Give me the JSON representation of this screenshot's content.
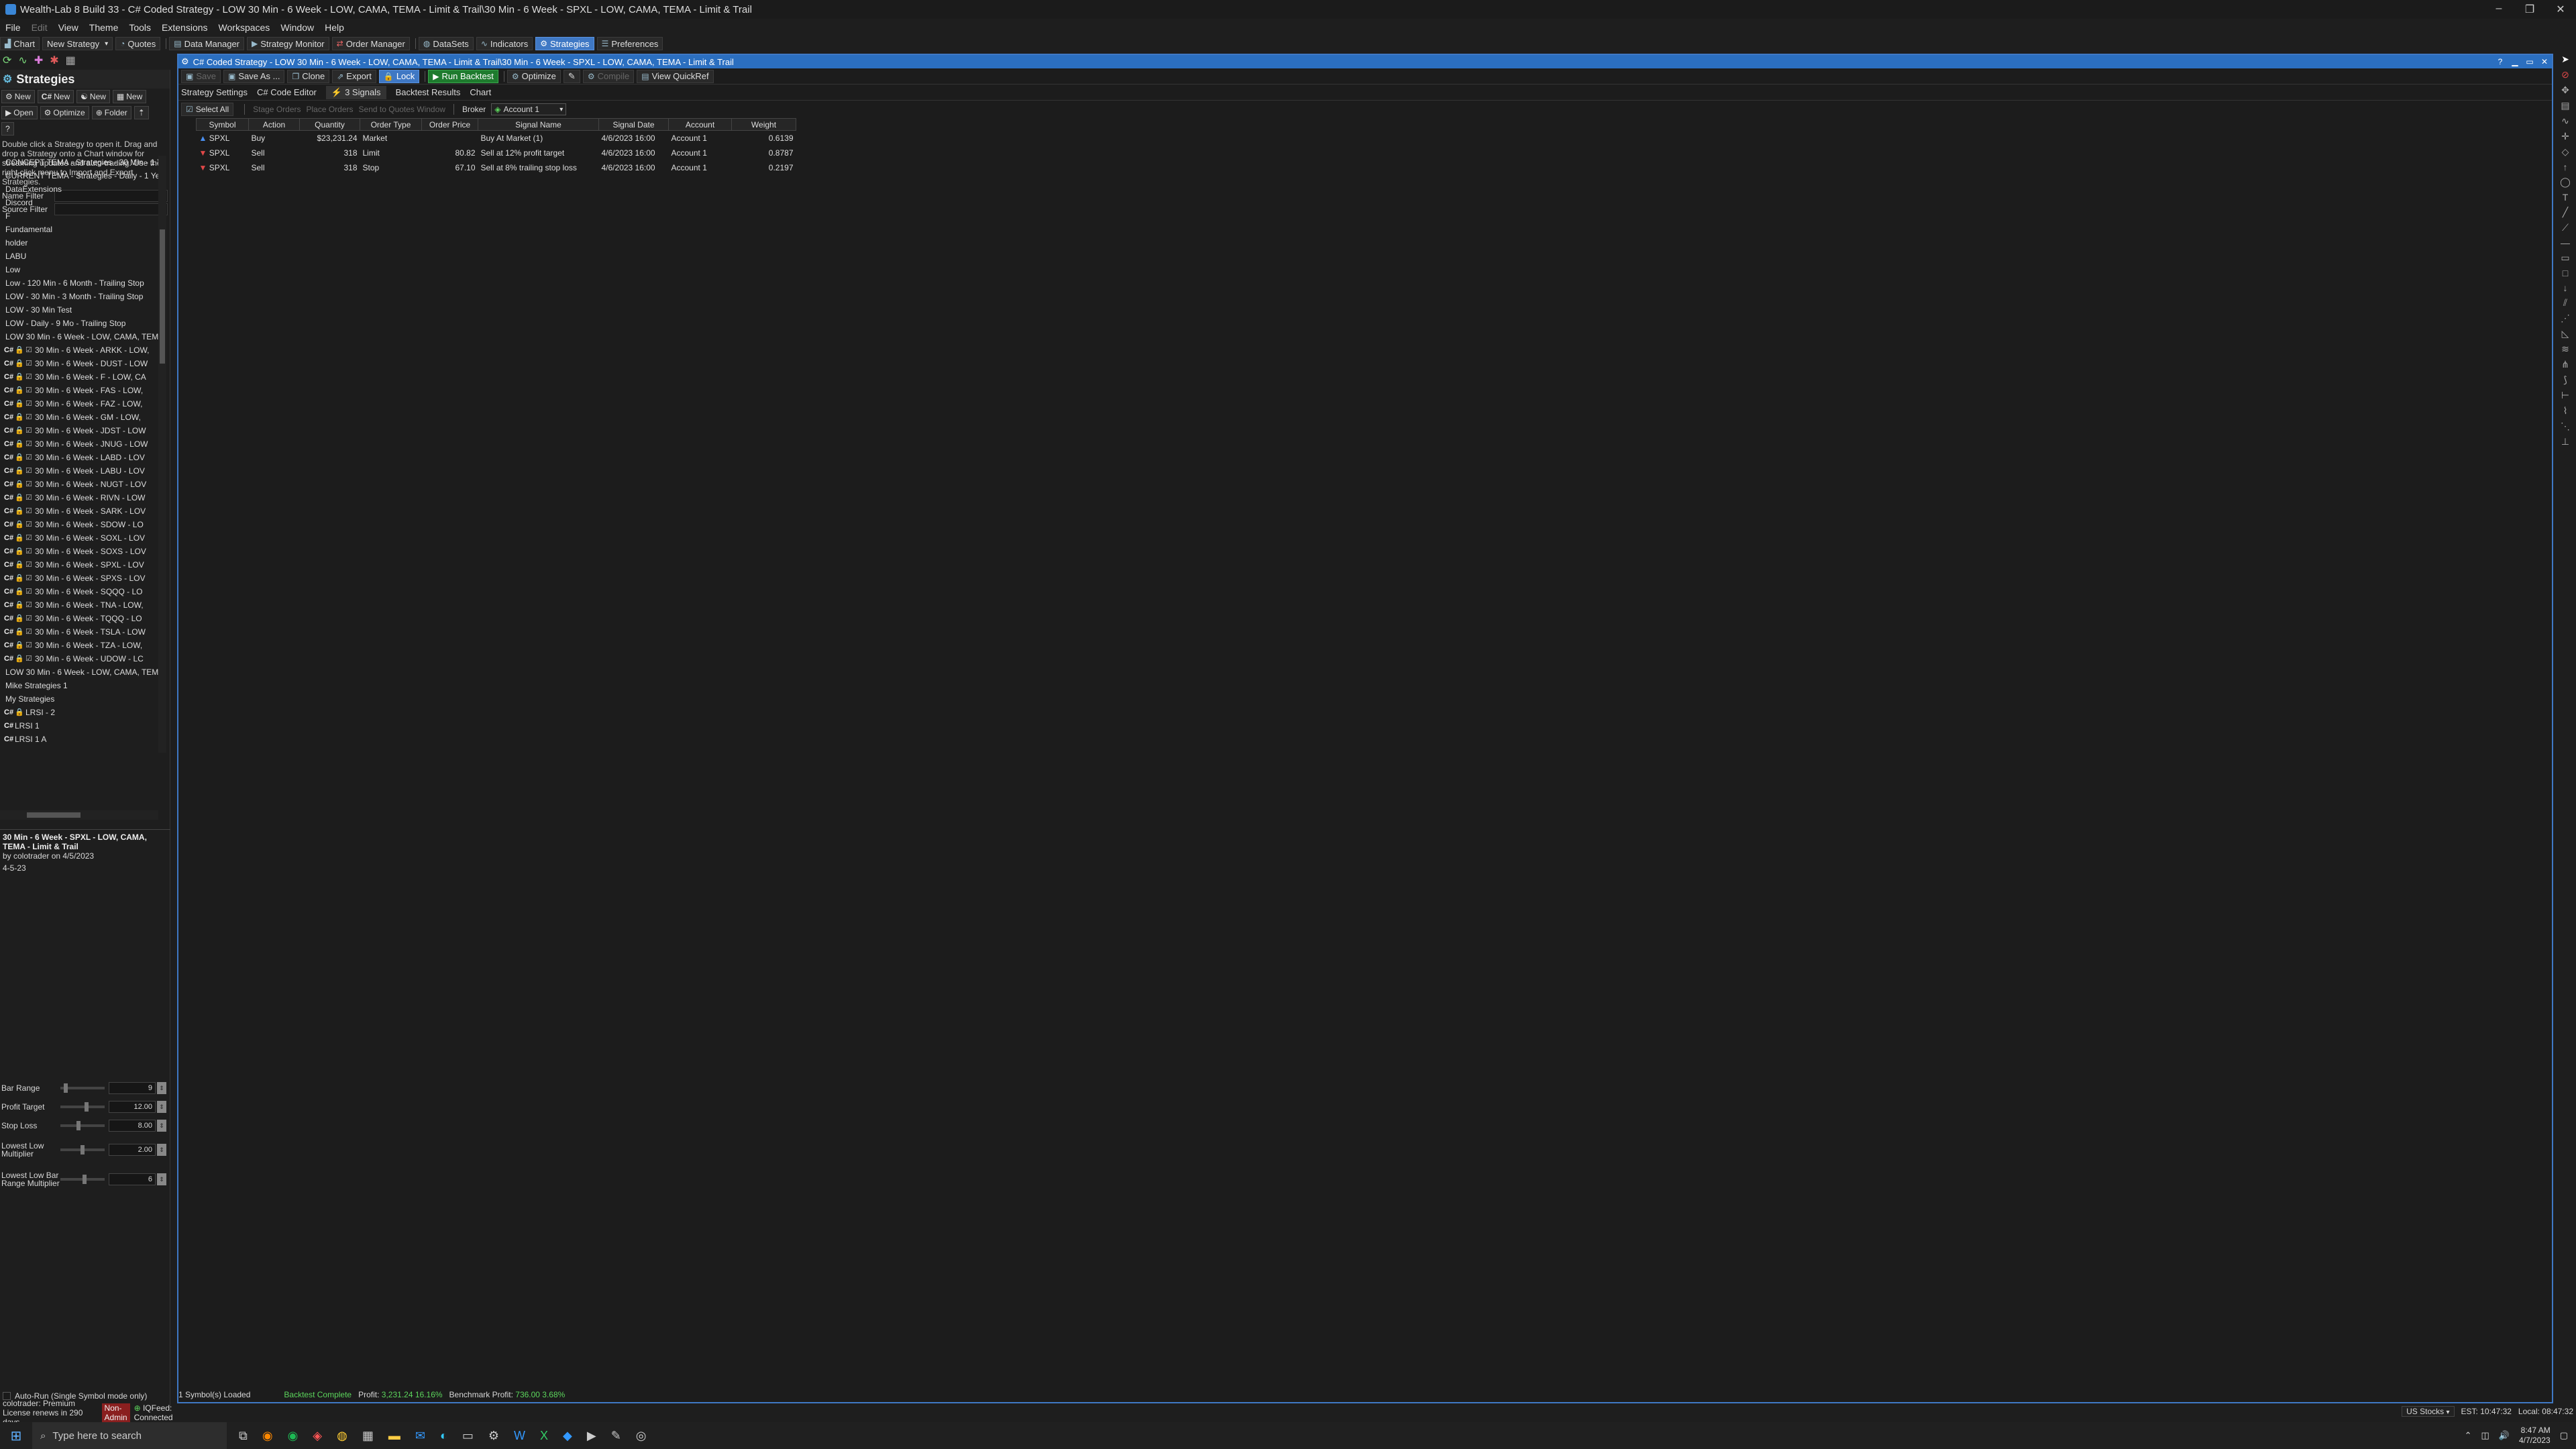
{
  "window": {
    "title": "Wealth-Lab 8 Build 33 - C# Coded Strategy - LOW 30 Min - 6 Week - LOW, CAMA, TEMA - Limit & Trail\\30 Min - 6 Week - SPXL - LOW, CAMA, TEMA - Limit & Trail",
    "controls": [
      "–",
      "❐",
      "✕"
    ]
  },
  "menu": [
    "File",
    "Edit",
    "View",
    "Theme",
    "Tools",
    "Extensions",
    "Workspaces",
    "Window",
    "Help"
  ],
  "toolbar": {
    "chart": "Chart",
    "new_strategy": "New Strategy",
    "quotes": "Quotes",
    "data_manager": "Data Manager",
    "strategy_monitor": "Strategy Monitor",
    "order_manager": "Order Manager",
    "datasets": "DataSets",
    "indicators": "Indicators",
    "strategies": "Strategies",
    "preferences": "Preferences"
  },
  "left": {
    "title": "Strategies",
    "new_buttons": [
      "New",
      "New",
      "New",
      "New"
    ],
    "actions": {
      "open": "Open",
      "optimize": "Optimize",
      "folder": "Folder"
    },
    "help_marker": "?",
    "help": "Double click a Strategy to open it. Drag and drop a Strategy onto a Chart window for streaming updates and auto-trading. Use the right click menu to Import and Export Strategies.",
    "name_filter": "Name Filter",
    "source_filter": "Source Filter",
    "folders_top": [
      "CONCEPT TEMA - Strategies - 30 Min - 1 Ye",
      "CURRENT TEMA - Strategies - Daily - 1 Year",
      "DataExtensions",
      "Discord",
      "F",
      "Fundamental",
      "holder",
      "LABU",
      "Low",
      "Low - 120 Min - 6 Month - Trailing Stop",
      "LOW - 30 Min - 3 Month - Trailing Stop",
      "LOW - 30 Min Test",
      "LOW - Daily - 9 Mo - Trailing Stop",
      "LOW 30 Min - 6 Week - LOW, CAMA, TEMA"
    ],
    "strategies": [
      "30 Min - 6 Week - ARKK - LOW,",
      "30 Min - 6 Week - DUST - LOW",
      "30 Min - 6 Week - F - LOW, CA",
      "30 Min - 6 Week - FAS - LOW,",
      "30 Min - 6 Week - FAZ - LOW,",
      "30 Min - 6 Week - GM - LOW,",
      "30 Min - 6 Week - JDST - LOW",
      "30 Min - 6 Week - JNUG - LOW",
      "30 Min - 6 Week - LABD - LOV",
      "30 Min - 6 Week - LABU - LOV",
      "30 Min - 6 Week - NUGT - LOV",
      "30 Min - 6 Week - RIVN - LOW",
      "30 Min - 6 Week - SARK - LOV",
      "30 Min - 6 Week - SDOW - LO",
      "30 Min - 6 Week - SOXL - LOV",
      "30 Min - 6 Week - SOXS - LOV",
      "30 Min - 6 Week - SPXL - LOV",
      "30 Min - 6 Week - SPXS - LOV",
      "30 Min - 6 Week - SQQQ - LO",
      "30 Min - 6 Week - TNA - LOW,",
      "30 Min - 6 Week - TQQQ - LO",
      "30 Min - 6 Week - TSLA - LOW",
      "30 Min - 6 Week - TZA - LOW,",
      "30 Min - 6 Week - UDOW - LC"
    ],
    "folders_bottom": [
      "LOW 30 Min - 6 Week - LOW, CAMA, TEM",
      "Mike Strategies 1",
      "My Strategies"
    ],
    "tail": [
      "LRSI - 2",
      "LRSI 1",
      "LRSI 1 A"
    ],
    "cs_label": "C#",
    "lock_glyph": "🔒",
    "check_glyph": "☑",
    "desc_title": "30 Min - 6 Week - SPXL - LOW, CAMA, TEMA - Limit & Trail",
    "desc_by": "by colotrader on 4/5/2023",
    "desc_note": "4-5-23",
    "params": [
      {
        "label": "Bar Range",
        "value": "9",
        "pos": 0.09
      },
      {
        "label": "Profit Target",
        "value": "12.00",
        "pos": 0.6
      },
      {
        "label": "Stop Loss",
        "value": "8.00",
        "pos": 0.4
      },
      {
        "label": "Lowest Low Multiplier",
        "value": "2.00",
        "pos": 0.5
      },
      {
        "label": "Lowest Low Bar Range Multiplier",
        "value": "6",
        "pos": 0.55
      }
    ],
    "autorun": "Auto-Run (Single Symbol mode only)"
  },
  "doc": {
    "title": "C# Coded Strategy - LOW 30 Min - 6 Week - LOW, CAMA, TEMA - Limit & Trail\\30 Min - 6 Week - SPXL - LOW, CAMA, TEMA - Limit & Trail",
    "buttons": {
      "save": "Save",
      "save_as": "Save As ...",
      "clone": "Clone",
      "export": "Export",
      "lock": "Lock",
      "run": "Run Backtest",
      "optimize": "Optimize",
      "compile": "Compile",
      "quickref": "View QuickRef"
    },
    "tabs": [
      "Strategy Settings",
      "C# Code Editor",
      "3 Signals",
      "Backtest Results",
      "Chart"
    ],
    "signals_bar": {
      "select_all": "Select All",
      "stage": "Stage Orders",
      "place": "Place Orders",
      "send": "Send to Quotes Window",
      "broker": "Broker",
      "account": "Account 1"
    },
    "columns": [
      "Symbol",
      "Action",
      "Quantity",
      "Order Type",
      "Order Price",
      "Signal Name",
      "Signal Date",
      "Account",
      "Weight"
    ],
    "rows": [
      {
        "symbol": "SPXL",
        "action": "Buy",
        "quantity": "$23,231.24",
        "order_type": "Market",
        "order_price": "",
        "signal_name": "Buy At Market (1)",
        "signal_date": "4/6/2023 16:00",
        "account": "Account 1",
        "weight": "0.6139"
      },
      {
        "symbol": "SPXL",
        "action": "Sell",
        "quantity": "318",
        "order_type": "Limit",
        "order_price": "80.82",
        "signal_name": "Sell at 12% profit target",
        "signal_date": "4/6/2023 16:00",
        "account": "Account 1",
        "weight": "0.8787"
      },
      {
        "symbol": "SPXL",
        "action": "Sell",
        "quantity": "318",
        "order_type": "Stop",
        "order_price": "67.10",
        "signal_name": "Sell at 8% trailing stop loss",
        "signal_date": "4/6/2023 16:00",
        "account": "Account 1",
        "weight": "0.2197"
      }
    ],
    "status": {
      "loaded": "1 Symbol(s) Loaded",
      "complete": "Backtest Complete",
      "profit_label": "Profit:",
      "profit": "3,231.24 16.16%",
      "bench_label": "Benchmark Profit:",
      "bench": "736.00 3.68%"
    }
  },
  "status": {
    "license": "colotrader: Premium License renews in 290 days",
    "non_admin": "Non-Admin",
    "feed": "IQFeed: Connected",
    "market": "US Stocks",
    "est": "EST: 10:47:32",
    "local": "Local: 08:47:32"
  },
  "taskbar": {
    "search_placeholder": "Type here to search",
    "time": "8:47 AM",
    "date": "4/7/2023"
  },
  "colors": {
    "accent": "#3f78c4",
    "buy": "#4a8ff0",
    "sell": "#e04848",
    "green": "#5cd65c"
  }
}
